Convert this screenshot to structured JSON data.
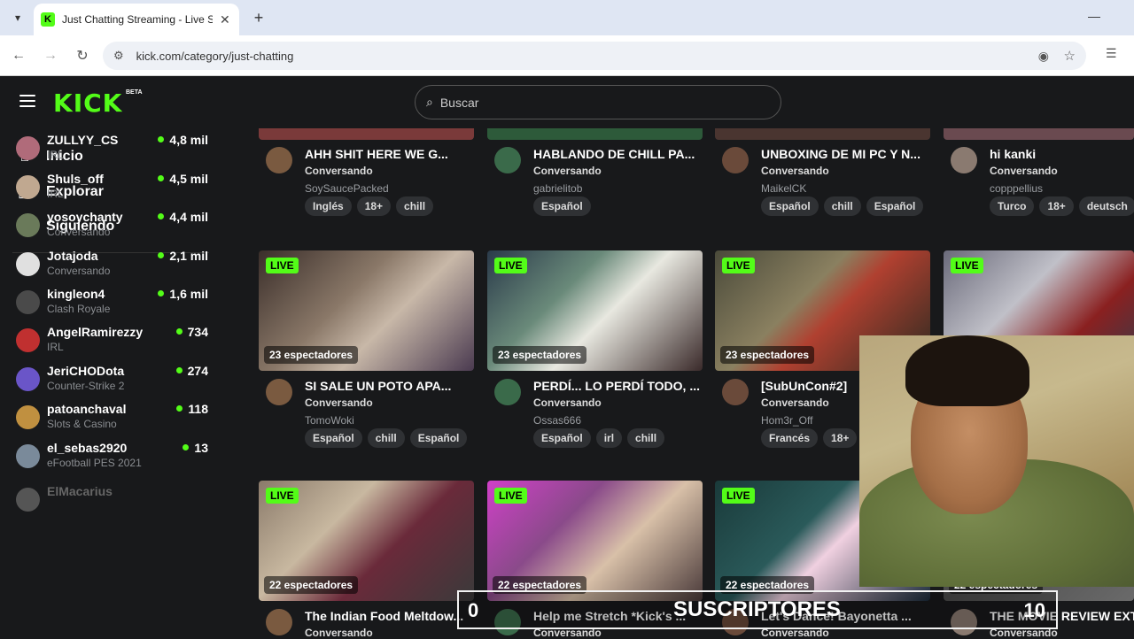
{
  "browser": {
    "tab_title": "Just Chatting Streaming - Live S",
    "url": "kick.com/category/just-chatting"
  },
  "header": {
    "logo": "KICK",
    "beta": "BETA",
    "search_placeholder": "Buscar"
  },
  "sidebar": {
    "nav": [
      {
        "label": "Inicio",
        "icon": "home-icon"
      },
      {
        "label": "Explorar",
        "icon": "compass-icon"
      },
      {
        "label": "Siguiendo",
        "icon": "heart-icon"
      }
    ],
    "channels": [
      {
        "name": "ZULLYY_CS",
        "category": "IRL",
        "viewers": "4,8 mil",
        "color": "#b06b7a"
      },
      {
        "name": "Shuls_off",
        "category": "IRL",
        "viewers": "4,5 mil",
        "color": "#c0a890"
      },
      {
        "name": "yosoychanty",
        "category": "Conversando",
        "viewers": "4,4 mil",
        "color": "#6a7a5a"
      },
      {
        "name": "Jotajoda",
        "category": "Conversando",
        "viewers": "2,1 mil",
        "color": "#e0e0e0"
      },
      {
        "name": "kingleon4",
        "category": "Clash Royale",
        "viewers": "1,6 mil",
        "color": "#4a4a4a"
      },
      {
        "name": "AngelRamirezzy",
        "category": "IRL",
        "viewers": "734",
        "color": "#c03030"
      },
      {
        "name": "JeriCHODota",
        "category": "Counter-Strike 2",
        "viewers": "274",
        "color": "#6a55c8"
      },
      {
        "name": "patoanchaval",
        "category": "Slots & Casino",
        "viewers": "118",
        "color": "#c09040"
      },
      {
        "name": "el_sebas2920",
        "category": "eFootball PES 2021",
        "viewers": "13",
        "color": "#7a8a9a"
      },
      {
        "name": "ElMacarius",
        "category": "",
        "viewers": "",
        "color": "#555555"
      }
    ]
  },
  "cards_row1": [
    {
      "title": "AHH SHIT HERE WE G...",
      "category": "Conversando",
      "user": "SoySaucePacked",
      "tags": [
        "Inglés",
        "18+",
        "chill"
      ],
      "strip": "#7a3a3a"
    },
    {
      "title": "HABLANDO DE CHILL PA...",
      "category": "Conversando",
      "user": "gabrielitob",
      "tags": [
        "Español"
      ],
      "strip": "#2d5a3a"
    },
    {
      "title": "UNBOXING DE MI PC Y N...",
      "category": "Conversando",
      "user": "MaikelCK",
      "tags": [
        "Español",
        "chill",
        "Español"
      ],
      "strip": "#4a3530"
    },
    {
      "title": "hi kanki",
      "category": "Conversando",
      "user": "copppellius",
      "tags": [
        "Turco",
        "18+",
        "deutsch"
      ],
      "strip": "#6a4a50"
    }
  ],
  "cards_row2": [
    {
      "title": "SI SALE UN POTO APA...",
      "category": "Conversando",
      "user": "TomoWoki",
      "tags": [
        "Español",
        "chill",
        "Español"
      ],
      "viewers": "23 espectadores",
      "live": "LIVE"
    },
    {
      "title": "PERDÍ... LO PERDÍ TODO, ...",
      "category": "Conversando",
      "user": "Ossas666",
      "tags": [
        "Español",
        "irl",
        "chill"
      ],
      "viewers": "23 espectadores",
      "live": "LIVE"
    },
    {
      "title": "[SubUnCon#2]",
      "category": "Conversando",
      "user": "Hom3r_Off",
      "tags": [
        "Francés",
        "18+"
      ],
      "viewers": "23 espectadores",
      "live": "LIVE"
    },
    {
      "title": "",
      "category": "",
      "user": "",
      "tags": [],
      "viewers": "",
      "live": "LIVE"
    }
  ],
  "cards_row3": [
    {
      "title": "The Indian Food Meltdow...",
      "category": "Conversando",
      "viewers": "22 espectadores",
      "live": "LIVE"
    },
    {
      "title": "Help me Stretch *Kick's ...",
      "category": "Conversando",
      "viewers": "22 espectadores",
      "live": "LIVE"
    },
    {
      "title": "Let's Dance! Bayonetta ...",
      "category": "Conversando",
      "viewers": "22 espectadores",
      "live": "LIVE"
    },
    {
      "title": "THE MOVIE REVIEW EXT...",
      "category": "Conversando",
      "viewers": "22 espectadores",
      "live": ""
    }
  ],
  "overlay": {
    "left_count": "0",
    "label": "SUSCRIPTORES",
    "right_count": "10"
  }
}
